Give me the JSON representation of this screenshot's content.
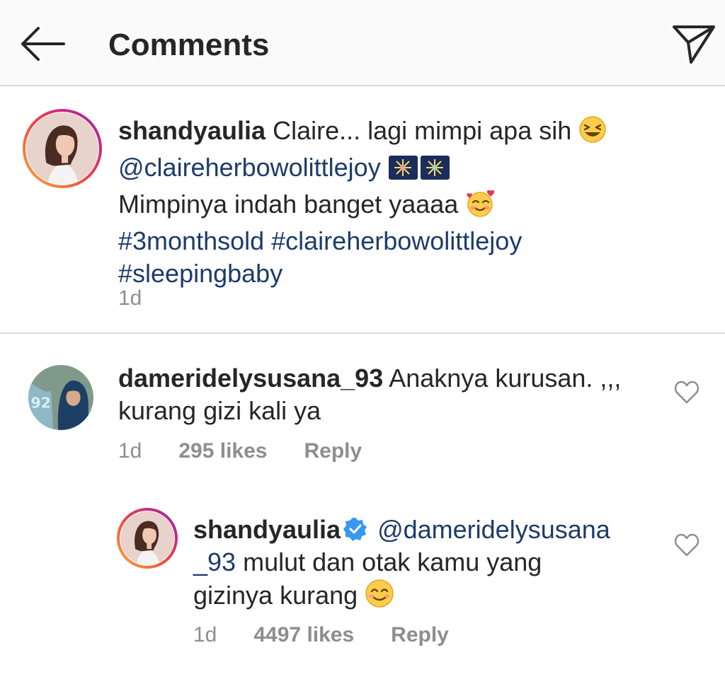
{
  "header": {
    "title": "Comments",
    "back_icon": "back-arrow-icon",
    "share_icon": "direct-message-icon"
  },
  "caption": {
    "username": "shandyaulia",
    "line1_text": " Claire... lagi mimpi apa sih ",
    "mention": "@claireherbowolittlejoy",
    "line3_text": "Mimpinya indah banget yaaaa ",
    "hashtags_line1": "#3monthsold #claireherbowolittlejoy",
    "hashtags_line2": "#sleepingbaby",
    "time": "1d"
  },
  "comments": [
    {
      "username": "dameridelysusana_93",
      "text_line1": " Anaknya kurusan. ,,,",
      "text_line2": "kurang gizi  kali ya",
      "time": "1d",
      "likes": "295 likes",
      "reply": "Reply"
    },
    {
      "username": "shandyaulia",
      "verified": true,
      "mention_part1": " @dameridelysusana",
      "mention_part2": "_93",
      "text_line2": " mulut dan otak kamu yang",
      "text_line3": "gizinya kurang ",
      "time": "1d",
      "likes": "4497 likes",
      "reply": "Reply"
    }
  ],
  "colors": {
    "link": "#1d3b6a",
    "muted": "#8e8e8e",
    "verified": "#3897f0",
    "divider": "#dbdbdb"
  }
}
